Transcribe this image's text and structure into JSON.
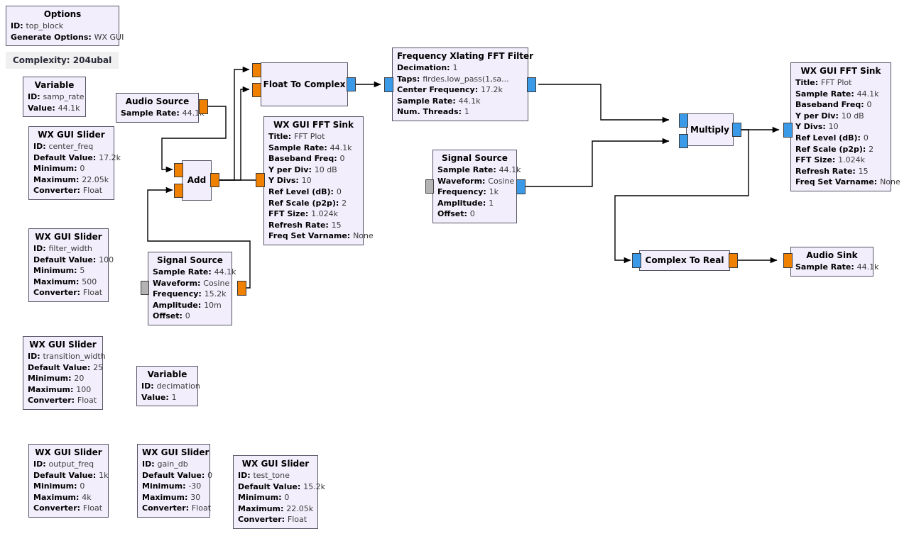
{
  "app": {
    "complexity_label": "Complexity: 204ubal"
  },
  "blocks": {
    "options": {
      "title": "Options",
      "params": [
        {
          "key": "ID:",
          "value": "top_block"
        },
        {
          "key": "Generate Options:",
          "value": "WX GUI"
        }
      ]
    },
    "var_samp_rate": {
      "title": "Variable",
      "params": [
        {
          "key": "ID:",
          "value": "samp_rate"
        },
        {
          "key": "Value:",
          "value": "44.1k"
        }
      ]
    },
    "var_decimation": {
      "title": "Variable",
      "params": [
        {
          "key": "ID:",
          "value": "decimation"
        },
        {
          "key": "Value:",
          "value": "1"
        }
      ]
    },
    "slider_center_freq": {
      "title": "WX GUI Slider",
      "params": [
        {
          "key": "ID:",
          "value": "center_freq"
        },
        {
          "key": "Default Value:",
          "value": "17.2k"
        },
        {
          "key": "Minimum:",
          "value": "0"
        },
        {
          "key": "Maximum:",
          "value": "22.05k"
        },
        {
          "key": "Converter:",
          "value": "Float"
        }
      ]
    },
    "slider_filter_width": {
      "title": "WX GUI Slider",
      "params": [
        {
          "key": "ID:",
          "value": "filter_width"
        },
        {
          "key": "Default Value:",
          "value": "100"
        },
        {
          "key": "Minimum:",
          "value": "5"
        },
        {
          "key": "Maximum:",
          "value": "500"
        },
        {
          "key": "Converter:",
          "value": "Float"
        }
      ]
    },
    "slider_transition_width": {
      "title": "WX GUI Slider",
      "params": [
        {
          "key": "ID:",
          "value": "transition_width"
        },
        {
          "key": "Default Value:",
          "value": "25"
        },
        {
          "key": "Minimum:",
          "value": "20"
        },
        {
          "key": "Maximum:",
          "value": "100"
        },
        {
          "key": "Converter:",
          "value": "Float"
        }
      ]
    },
    "slider_output_freq": {
      "title": "WX GUI Slider",
      "params": [
        {
          "key": "ID:",
          "value": "output_freq"
        },
        {
          "key": "Default Value:",
          "value": "1k"
        },
        {
          "key": "Minimum:",
          "value": "0"
        },
        {
          "key": "Maximum:",
          "value": "4k"
        },
        {
          "key": "Converter:",
          "value": "Float"
        }
      ]
    },
    "slider_gain_db": {
      "title": "WX GUI Slider",
      "params": [
        {
          "key": "ID:",
          "value": "gain_db"
        },
        {
          "key": "Default Value:",
          "value": "0"
        },
        {
          "key": "Minimum:",
          "value": "-30"
        },
        {
          "key": "Maximum:",
          "value": "30"
        },
        {
          "key": "Converter:",
          "value": "Float"
        }
      ]
    },
    "slider_test_tone": {
      "title": "WX GUI Slider",
      "params": [
        {
          "key": "ID:",
          "value": "test_tone"
        },
        {
          "key": "Default Value:",
          "value": "15.2k"
        },
        {
          "key": "Minimum:",
          "value": "0"
        },
        {
          "key": "Maximum:",
          "value": "22.05k"
        },
        {
          "key": "Converter:",
          "value": "Float"
        }
      ]
    },
    "audio_source": {
      "title": "Audio Source",
      "params": [
        {
          "key": "Sample Rate:",
          "value": "44.1k"
        }
      ]
    },
    "add": {
      "title": "Add"
    },
    "float_to_complex": {
      "title": "Float To Complex"
    },
    "signal_source_left": {
      "title": "Signal Source",
      "params": [
        {
          "key": "Sample Rate:",
          "value": "44.1k"
        },
        {
          "key": "Waveform:",
          "value": "Cosine"
        },
        {
          "key": "Frequency:",
          "value": "15.2k"
        },
        {
          "key": "Amplitude:",
          "value": "10m"
        },
        {
          "key": "Offset:",
          "value": "0"
        }
      ]
    },
    "signal_source_right": {
      "title": "Signal Source",
      "params": [
        {
          "key": "Sample Rate:",
          "value": "44.1k"
        },
        {
          "key": "Waveform:",
          "value": "Cosine"
        },
        {
          "key": "Frequency:",
          "value": "1k"
        },
        {
          "key": "Amplitude:",
          "value": "1"
        },
        {
          "key": "Offset:",
          "value": "0"
        }
      ]
    },
    "fft_sink_left": {
      "title": "WX GUI FFT Sink",
      "params": [
        {
          "key": "Title:",
          "value": "FFT Plot"
        },
        {
          "key": "Sample Rate:",
          "value": "44.1k"
        },
        {
          "key": "Baseband Freq:",
          "value": "0"
        },
        {
          "key": "Y per Div:",
          "value": "10 dB"
        },
        {
          "key": "Y Divs:",
          "value": "10"
        },
        {
          "key": "Ref Level (dB):",
          "value": "0"
        },
        {
          "key": "Ref Scale (p2p):",
          "value": "2"
        },
        {
          "key": "FFT Size:",
          "value": "1.024k"
        },
        {
          "key": "Refresh Rate:",
          "value": "15"
        },
        {
          "key": "Freq Set Varname:",
          "value": "None"
        }
      ]
    },
    "fft_sink_right": {
      "title": "WX GUI FFT Sink",
      "params": [
        {
          "key": "Title:",
          "value": "FFT Plot"
        },
        {
          "key": "Sample Rate:",
          "value": "44.1k"
        },
        {
          "key": "Baseband Freq:",
          "value": "0"
        },
        {
          "key": "Y per Div:",
          "value": "10 dB"
        },
        {
          "key": "Y Divs:",
          "value": "10"
        },
        {
          "key": "Ref Level (dB):",
          "value": "0"
        },
        {
          "key": "Ref Scale (p2p):",
          "value": "2"
        },
        {
          "key": "FFT Size:",
          "value": "1.024k"
        },
        {
          "key": "Refresh Rate:",
          "value": "15"
        },
        {
          "key": "Freq Set Varname:",
          "value": "None"
        }
      ]
    },
    "freq_xlating": {
      "title": "Frequency Xlating FFT Filter",
      "params": [
        {
          "key": "Decimation:",
          "value": "1"
        },
        {
          "key": "Taps:",
          "value": "firdes.low_pass(1,sa..."
        },
        {
          "key": "Center Frequency:",
          "value": "17.2k"
        },
        {
          "key": "Sample Rate:",
          "value": "44.1k"
        },
        {
          "key": "Num. Threads:",
          "value": "1"
        }
      ]
    },
    "multiply": {
      "title": "Multiply"
    },
    "complex_to_real": {
      "title": "Complex To Real"
    },
    "audio_sink": {
      "title": "Audio Sink",
      "params": [
        {
          "key": "Sample Rate:",
          "value": "44.1k"
        }
      ]
    }
  },
  "colors": {
    "block_fill": "#f2eefc",
    "block_border": "#555566",
    "port_float": "#f08000",
    "port_complex": "#3a9ae8",
    "port_message": "#b3b3b3",
    "canvas": "#ffffff",
    "complexity_bg": "#f0f0f0"
  }
}
